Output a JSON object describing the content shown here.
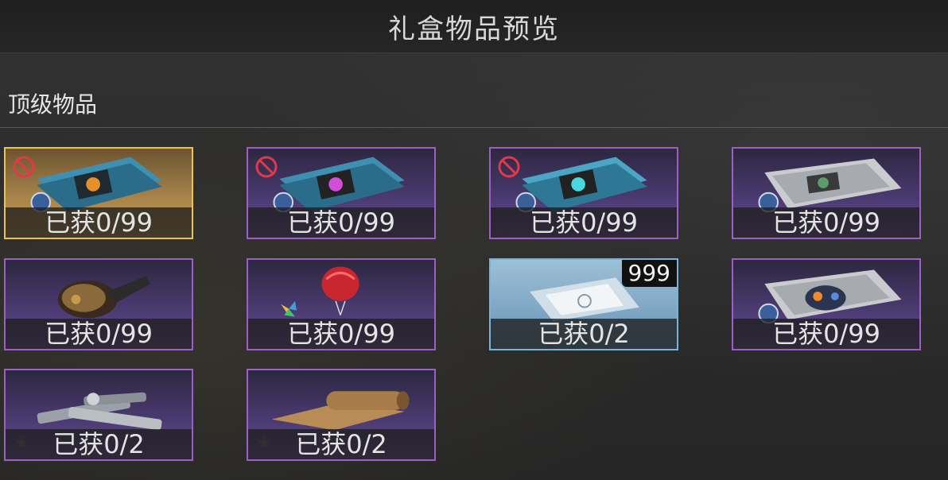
{
  "header": {
    "title": "礼盒物品预览"
  },
  "section": {
    "label": "顶级物品"
  },
  "items": [
    {
      "count_text": "已获0/99",
      "rarity": "gold",
      "art": "blueprint-book-orange",
      "banned": true
    },
    {
      "count_text": "已获0/99",
      "rarity": "purple",
      "art": "blueprint-book-pink",
      "banned": true
    },
    {
      "count_text": "已获0/99",
      "rarity": "purple",
      "art": "blueprint-book-cyan",
      "banned": true
    },
    {
      "count_text": "已获0/99",
      "rarity": "purple",
      "art": "blueprint-paper",
      "banned": false
    },
    {
      "count_text": "已获0/99",
      "rarity": "purple",
      "art": "armored-gauntlet",
      "banned": false
    },
    {
      "count_text": "已获0/99",
      "rarity": "purple",
      "art": "pinwheel-balloon",
      "banned": false
    },
    {
      "count_text": "已获0/2",
      "rarity": "blue",
      "art": "sealed-packet",
      "banned": false,
      "badge": "999"
    },
    {
      "count_text": "已获0/99",
      "rarity": "purple",
      "art": "blueprint-paper-drone",
      "banned": false
    },
    {
      "count_text": "已获0/2",
      "rarity": "purple",
      "art": "metal-bolts",
      "banned": false,
      "star_icon": true
    },
    {
      "count_text": "已获0/2",
      "rarity": "purple",
      "art": "parchment-scroll",
      "banned": false,
      "star_icon": true
    }
  ],
  "colors": {
    "gold_border": "#f0c24a",
    "purple_border": "#9b5fc7",
    "blue_border": "#7ab3d8",
    "ban_red": "#e0394a"
  }
}
